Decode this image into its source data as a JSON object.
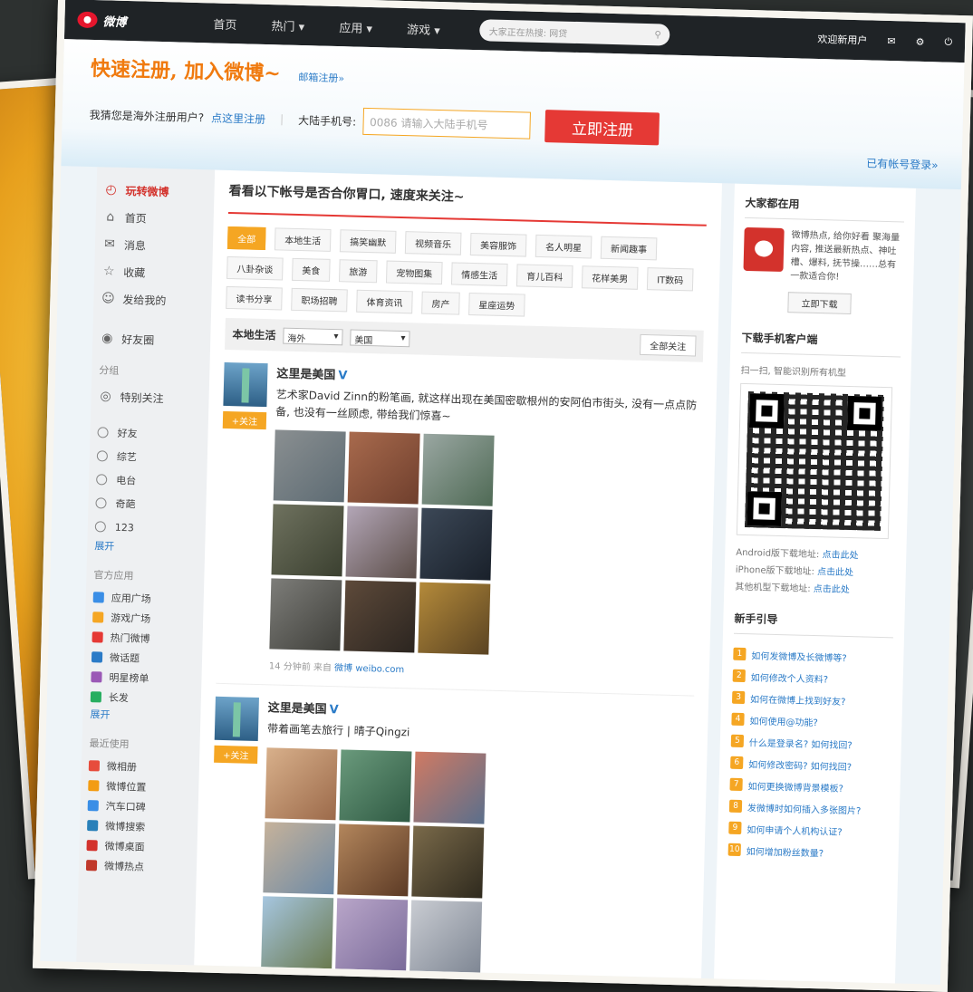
{
  "topbar": {
    "logo_text": "微博",
    "nav": [
      "首页",
      "热门 ▾",
      "应用 ▾",
      "游戏 ▾"
    ],
    "search_placeholder": "大家正在热搜: 网贷",
    "welcome": "欢迎新用户"
  },
  "register": {
    "title": "快速注册, 加入微博~",
    "email_link": "邮箱注册»",
    "overseas_prompt": "我猜您是海外注册用户?",
    "overseas_link": "点这里注册",
    "phone_label": "大陆手机号:",
    "phone_placeholder": "0086 请输入大陆手机号",
    "submit": "立即注册",
    "login_link": "已有帐号登录»"
  },
  "sidebar": {
    "header": "玩转微博",
    "items": [
      "首页",
      "消息",
      "收藏",
      "发给我的"
    ],
    "circle": "好友圈",
    "group_label": "分组",
    "special": "特别关注",
    "groups": [
      "好友",
      "综艺",
      "电台",
      "奇葩",
      "123"
    ],
    "expand": "展开",
    "official_label": "官方应用",
    "apps": [
      "应用广场",
      "游戏广场",
      "热门微博",
      "微话题",
      "明星榜单",
      "长发"
    ],
    "expand2": "展开",
    "recent_label": "最近使用",
    "recent": [
      "微相册",
      "微博位置",
      "汽车口碑",
      "微博搜索",
      "微博桌面",
      "微博热点"
    ]
  },
  "main": {
    "heading": "看看以下帐号是否合你胃口, 速度来关注~",
    "tags": [
      "全部",
      "本地生活",
      "搞笑幽默",
      "视频音乐",
      "美容服饰",
      "名人明星",
      "新闻趣事",
      "八卦杂谈",
      "美食",
      "旅游",
      "宠物图集",
      "情感生活",
      "育儿百科",
      "花样美男",
      "IT数码",
      "读书分享",
      "职场招聘",
      "体育资讯",
      "房产",
      "星座运势"
    ],
    "filter_label": "本地生活",
    "filter_country": "海外",
    "filter_region": "美国",
    "follow_all": "全部关注",
    "posts": [
      {
        "name": "这里是美国",
        "follow": "+关注",
        "text": "艺术家David Zinn的粉笔画, 就这样出现在美国密歇根州的安阿伯市街头, 没有一点点防备, 也没有一丝顾虑, 带给我们惊喜~",
        "time": "14 分钟前",
        "source_prefix": "来自",
        "source": "微博 weibo.com"
      },
      {
        "name": "这里是美国",
        "follow": "+关注",
        "text": "带着画笔去旅行 | 晴子Qingzi"
      }
    ]
  },
  "right": {
    "using_title": "大家都在用",
    "app_desc": "微博热点, 给你好看 聚海量内容, 推送最新热点、神吐槽、爆料, 抚节操……总有一款适合你!",
    "download": "立即下载",
    "client_title": "下载手机客户端",
    "qr_hint": "扫一扫, 智能识别所有机型",
    "android": "Android版下载地址:",
    "iphone": "iPhone版下载地址:",
    "other": "其他机型下载地址:",
    "click_here": "点击此处",
    "guide_title": "新手引导",
    "guide": [
      "如何发微博及长微博等?",
      "如何修改个人资料?",
      "如何在微博上找到好友?",
      "如何使用@功能?",
      "什么是登录名? 如何找回?",
      "如何修改密码? 如何找回?",
      "如何更换微博背景模板?",
      "发微博时如何插入多张图片?",
      "如何申请个人机构认证?",
      "如何增加粉丝数量?"
    ]
  },
  "colors": {
    "accent": "#e53935",
    "orange": "#f5a623",
    "link": "#2b7bc7"
  }
}
